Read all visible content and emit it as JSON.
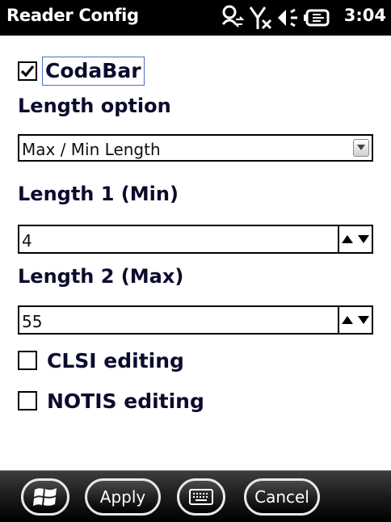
{
  "status_bar": {
    "title": "Reader Config",
    "clock": "3:04",
    "icons": [
      "sync-person-icon",
      "signal-off-icon",
      "speaker-icon",
      "battery-plug-icon"
    ]
  },
  "form": {
    "symbology": {
      "label": "CodaBar",
      "checked": true
    },
    "length_option": {
      "heading": "Length option",
      "selected": "Max / Min Length"
    },
    "length1": {
      "heading": "Length 1 (Min)",
      "value": "4"
    },
    "length2": {
      "heading": "Length 2 (Max)",
      "value": "55"
    },
    "clsi": {
      "label": "CLSI editing",
      "checked": false
    },
    "notis": {
      "label": "NOTIS editing",
      "checked": false
    }
  },
  "bottom_bar": {
    "start_icon": "windows-start-icon",
    "apply_label": "Apply",
    "keyboard_icon": "keyboard-icon",
    "cancel_label": "Cancel"
  },
  "colors": {
    "label_text": "#0b0b2d",
    "focus_border": "#4a6fc4",
    "bar_background": "#000000"
  }
}
